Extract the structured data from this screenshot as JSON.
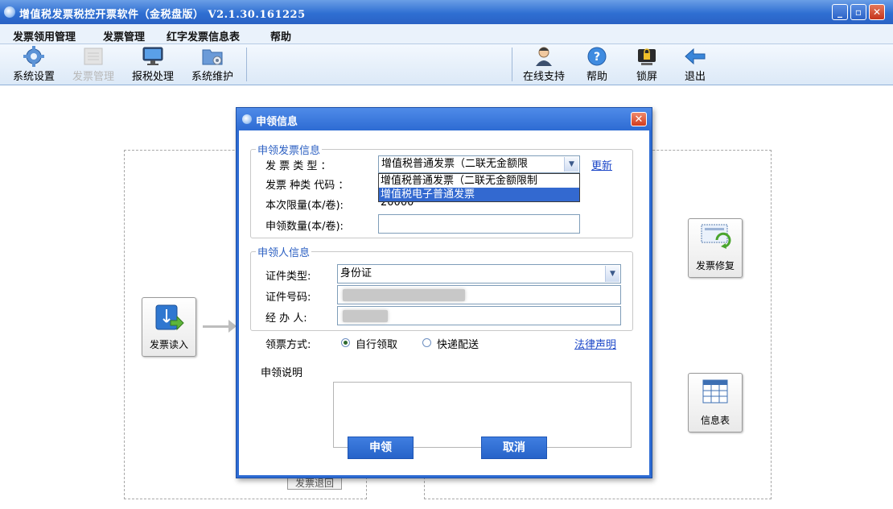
{
  "window": {
    "title": "增值税发票税控开票软件（金税盘版） V2.1.30.161225",
    "controls": [
      "minimize-icon",
      "maximize-icon",
      "close-icon"
    ]
  },
  "menu": {
    "items": [
      "发票领用管理",
      "发票管理",
      "红字发票信息表",
      "帮助"
    ]
  },
  "toolbar": {
    "left": [
      {
        "label": "系统设置",
        "icon": "gear-icon",
        "enabled": true
      },
      {
        "label": "发票管理",
        "icon": "invoice-icon",
        "enabled": false
      },
      {
        "label": "报税处理",
        "icon": "monitor-icon",
        "enabled": true
      },
      {
        "label": "系统维护",
        "icon": "folder-gear-icon",
        "enabled": true
      }
    ],
    "right": [
      {
        "label": "在线支持",
        "icon": "support-person-icon"
      },
      {
        "label": "帮助",
        "icon": "help-icon"
      },
      {
        "label": "锁屏",
        "icon": "lock-screen-icon"
      },
      {
        "label": "退出",
        "icon": "exit-arrow-icon"
      }
    ]
  },
  "canvas": {
    "read_button": "发票读入",
    "repair_button": "发票修复",
    "info_button": "信息表",
    "return_button": "发票退回"
  },
  "dialog": {
    "title": "申领信息",
    "close": "✕",
    "invoice_section": {
      "legend": "申领发票信息",
      "type_label": "发  票  类  型 ：",
      "type_value": "增值税普通发票（二联无金额限",
      "update_link": "更新",
      "code_label": "发票 种类 代码 ：",
      "limit_label": "本次限量(本/卷):",
      "limit_value": "20000",
      "qty_label": "申领数量(本/卷):",
      "qty_value": "",
      "dropdown_options": [
        "增值税普通发票（二联无金额限制",
        "增值税电子普通发票"
      ],
      "dropdown_selected": 1
    },
    "applicant_section": {
      "legend": "申领人信息",
      "id_type_label": "证件类型:",
      "id_type_value": "身份证",
      "id_number_label": "证件号码:",
      "handler_label": "经 办 人:"
    },
    "pickup": {
      "label": "领票方式:",
      "options": [
        "自行领取",
        "快递配送"
      ],
      "selected": 0,
      "legal_link": "法律声明"
    },
    "note_label": "申领说明",
    "note_value": "",
    "apply_button": "申领",
    "cancel_button": "取消"
  }
}
